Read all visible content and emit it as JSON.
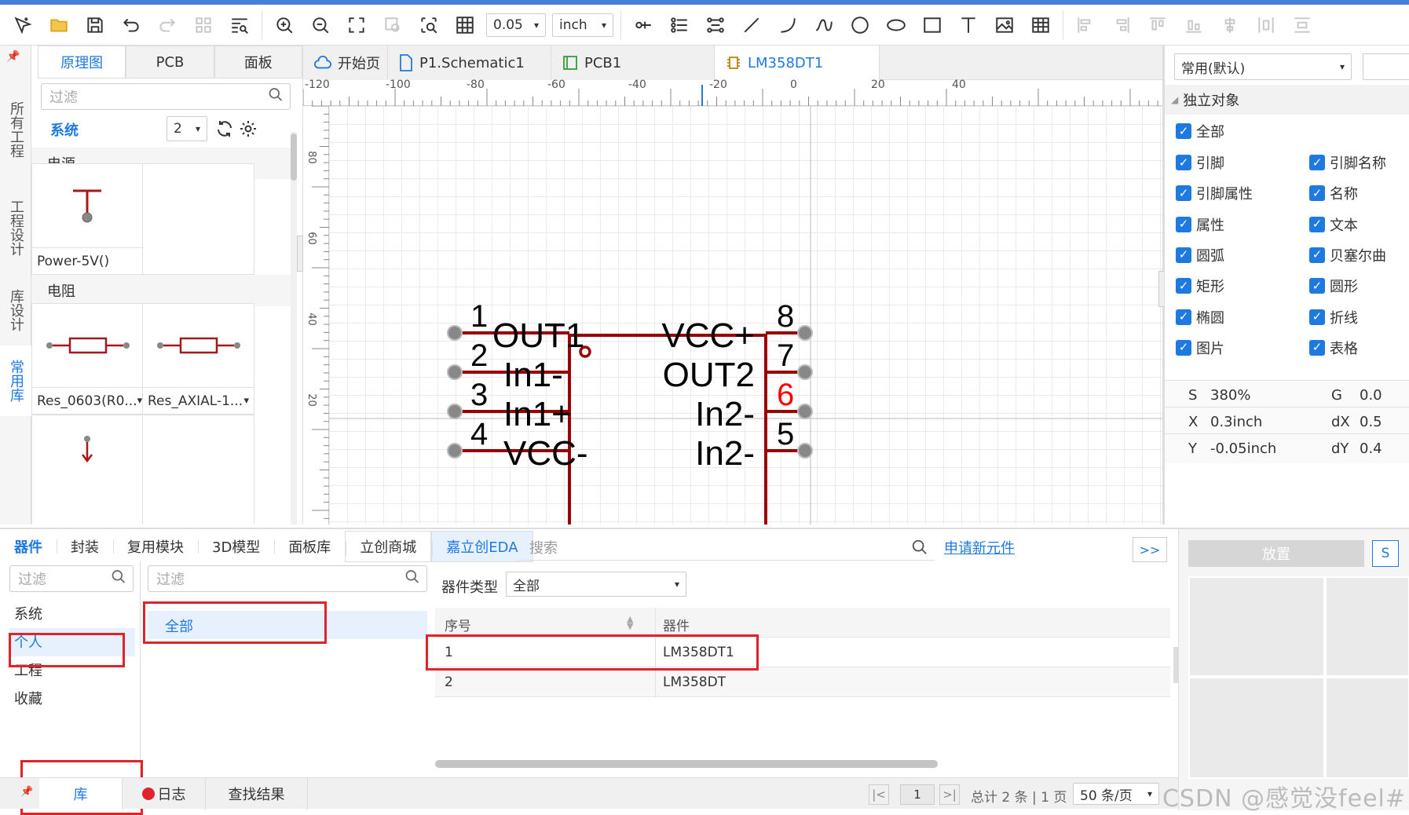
{
  "toolbar": {
    "grid_value": "0.05",
    "unit": "inch"
  },
  "left_vtabs": [
    "所有工程",
    "工程设计",
    "库设计",
    "常用库"
  ],
  "left_panel": {
    "tabs": [
      "原理图",
      "PCB",
      "面板"
    ],
    "filter_placeholder": "过滤",
    "system_label": "系统",
    "count_value": "2",
    "sections": [
      {
        "title": "电源",
        "items": [
          "Power-5V()"
        ]
      },
      {
        "title": "电阻",
        "items": [
          "Res_0603(R0...",
          "Res_AXIAL-1..."
        ]
      }
    ]
  },
  "doc_tabs": [
    "开始页",
    "P1.Schematic1",
    "PCB1",
    "LM358DT1"
  ],
  "ruler": {
    "h_labels": [
      "-120",
      "-100",
      "-80",
      "-60",
      "-40",
      "-20",
      "0",
      "20",
      "40"
    ],
    "v_labels": [
      "80",
      "60",
      "40",
      "20"
    ]
  },
  "schematic": {
    "left_pins": [
      {
        "num": "1",
        "name": "OUT1"
      },
      {
        "num": "2",
        "name": "In1-"
      },
      {
        "num": "3",
        "name": "In1+"
      },
      {
        "num": "4",
        "name": "VCC-"
      }
    ],
    "right_pins": [
      {
        "num": "8",
        "name": "VCC+"
      },
      {
        "num": "7",
        "name": "OUT2"
      },
      {
        "num": "6",
        "name": "In2-"
      },
      {
        "num": "5",
        "name": "In2-"
      }
    ],
    "color": "#990000",
    "highlight_color": "#ff0000"
  },
  "right_panel": {
    "dropdown": "常用(默认)",
    "section_title": "独立对象",
    "all_label": "全部",
    "checks_left": [
      "引脚",
      "引脚属性",
      "属性",
      "圆弧",
      "矩形",
      "椭圆",
      "图片"
    ],
    "checks_right": [
      "引脚名称",
      "名称",
      "文本",
      "贝塞尔曲",
      "圆形",
      "折线",
      "表格"
    ],
    "props": [
      {
        "k": "S",
        "v": "380%",
        "k2": "G",
        "v2": "0.0"
      },
      {
        "k": "X",
        "v": "0.3inch",
        "k2": "dX",
        "v2": "0.5"
      },
      {
        "k": "Y",
        "v": "-0.05inch",
        "k2": "dY",
        "v2": "0.4"
      }
    ]
  },
  "bottom": {
    "tabs": [
      "器件",
      "封装",
      "复用模块",
      "3D模型",
      "面板库",
      "立创商城",
      "嘉立创EDA"
    ],
    "search_placeholder": "搜索",
    "new_link": "申请新元件",
    "nav": ">>",
    "filter_placeholder": "过滤",
    "categories": [
      "系统",
      "个人",
      "工程",
      "收藏"
    ],
    "sub_filter_placeholder": "过滤",
    "sub_all": "全部",
    "type_label": "器件类型",
    "type_value": "全部",
    "table_headers": [
      "序号",
      "器件"
    ],
    "rows": [
      {
        "no": "1",
        "name": "LM358DT1"
      },
      {
        "no": "2",
        "name": "LM358DT"
      }
    ],
    "status_tabs": [
      "库",
      "日志",
      "查找结果"
    ],
    "page_current": "1",
    "page_summary": "总计 2 条 | 1 页",
    "page_size": "50 条/页",
    "place_label": "放置",
    "s_label": "S",
    "watermark": "CSDN @感觉没feel#"
  },
  "colors": {
    "accent": "#1e7ae0",
    "red": "#e0222a"
  }
}
